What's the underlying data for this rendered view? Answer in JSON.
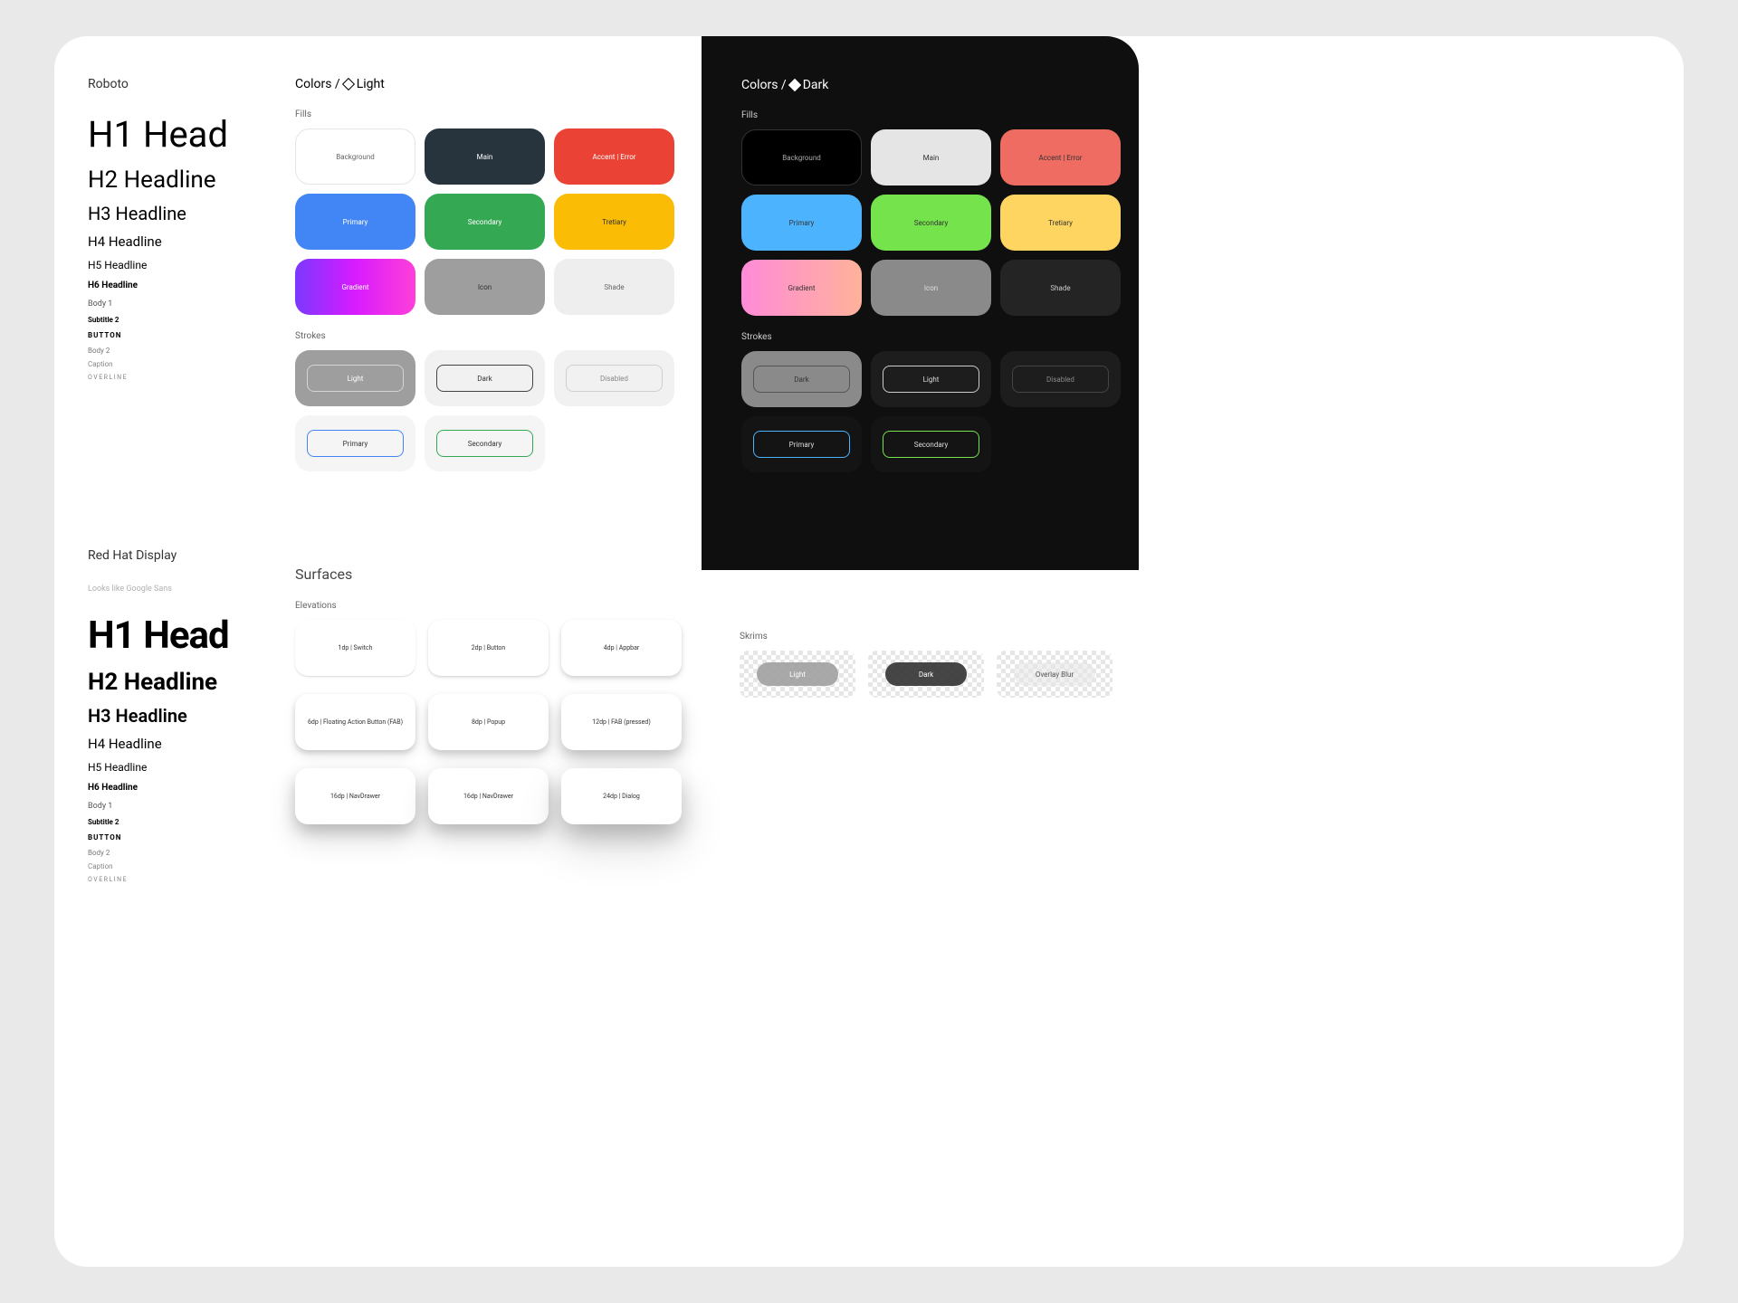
{
  "typography": {
    "roboto": {
      "title": "Roboto",
      "h1": "H1 Head",
      "h2": "H2 Headline",
      "h3": "H3 Headline",
      "h4": "H4 Headline",
      "h5": "H5 Headline",
      "h6": "H6 Headline",
      "body1": "Body 1",
      "subtitle2": "Subtitle 2",
      "button": "BUTTON",
      "body2": "Body 2",
      "caption": "Caption",
      "overline": "OVERLINE"
    },
    "redhat": {
      "title": "Red Hat Display",
      "subtitle": "Looks like Google Sans",
      "h1": "H1 Head",
      "h2": "H2 Headline",
      "h3": "H3 Headline",
      "h4": "H4 Headline",
      "h5": "H5 Headline",
      "h6": "H6 Headline",
      "body1": "Body 1",
      "subtitle2": "Subtitle 2",
      "button": "BUTTON",
      "body2": "Body 2",
      "caption": "Caption",
      "overline": "OVERLINE"
    }
  },
  "light": {
    "title_prefix": "Colors /",
    "title_mode": "Light",
    "fills_label": "Fills",
    "fills": [
      {
        "name": "Background",
        "color": "#ffffff",
        "text": "#666",
        "border": true
      },
      {
        "name": "Main",
        "color": "#27333d",
        "text": "#fff"
      },
      {
        "name": "Accent | Error",
        "color": "#ea4335",
        "text": "#fff"
      },
      {
        "name": "Primary",
        "color": "#4285f4",
        "text": "#fff"
      },
      {
        "name": "Secondary",
        "color": "#34a853",
        "text": "#fff"
      },
      {
        "name": "Tretiary",
        "color": "#fbbc05",
        "text": "#333"
      },
      {
        "name": "Gradient",
        "gradient": "linear-gradient(90deg,#7b38ff,#d81bff,#ff3fd8)",
        "text": "#fff"
      },
      {
        "name": "Icon",
        "color": "#9e9e9e",
        "text": "#333"
      },
      {
        "name": "Shade",
        "color": "#eeeeee",
        "text": "#666"
      }
    ],
    "strokes_label": "Strokes",
    "strokes": [
      {
        "name": "Light",
        "outer": "#9e9e9e",
        "inner_border": "#d4d4d4",
        "text": "#fff"
      },
      {
        "name": "Dark",
        "outer": "#f1f1f1",
        "inner_border": "#444",
        "text": "#333"
      },
      {
        "name": "Disabled",
        "outer": "#f1f1f1",
        "inner_border": "#cfcfcf",
        "text": "#888"
      },
      {
        "name": "Primary",
        "outer": "#f5f5f5",
        "inner_border": "#4285f4",
        "text": "#333"
      },
      {
        "name": "Secondary",
        "outer": "#f5f5f5",
        "inner_border": "#34a853",
        "text": "#333"
      }
    ]
  },
  "dark": {
    "title_prefix": "Colors /",
    "title_mode": "Dark",
    "fills_label": "Fills",
    "fills": [
      {
        "name": "Background",
        "color": "#000000",
        "text": "#aaa",
        "border": true
      },
      {
        "name": "Main",
        "color": "#e5e5e5",
        "text": "#333"
      },
      {
        "name": "Accent | Error",
        "color": "#ef6c62",
        "text": "#333"
      },
      {
        "name": "Primary",
        "color": "#4cb4ff",
        "text": "#333"
      },
      {
        "name": "Secondary",
        "color": "#74e34c",
        "text": "#333"
      },
      {
        "name": "Tretiary",
        "color": "#ffd561",
        "text": "#333"
      },
      {
        "name": "Gradient",
        "gradient": "linear-gradient(90deg,#ff8bd8,#ffb29a)",
        "text": "#333"
      },
      {
        "name": "Icon",
        "color": "#8a8a8a",
        "text": "#ddd"
      },
      {
        "name": "Shade",
        "color": "#242424",
        "text": "#ccc"
      }
    ],
    "strokes_label": "Strokes",
    "strokes": [
      {
        "name": "Dark",
        "outer": "#8a8a8a",
        "inner_border": "#555",
        "text": "#333"
      },
      {
        "name": "Light",
        "outer": "#1d1d1d",
        "inner_border": "#ccc",
        "text": "#ddd"
      },
      {
        "name": "Disabled",
        "outer": "#1d1d1d",
        "inner_border": "#444",
        "text": "#888"
      },
      {
        "name": "Primary",
        "outer": "#141414",
        "inner_border": "#4cb4ff",
        "text": "#ddd"
      },
      {
        "name": "Secondary",
        "outer": "#141414",
        "inner_border": "#74e34c",
        "text": "#ddd"
      }
    ]
  },
  "surfaces": {
    "title": "Surfaces",
    "elev_label": "Elevations",
    "elevations": [
      "1dp | Switch",
      "2dp | Button",
      "4dp | Appbar",
      "6dp | Floating Action Button (FAB)",
      "8dp | Popup",
      "12dp | FAB (pressed)",
      "16dp | NavDrawer",
      "16dp | NavDrawer",
      "24dp | Dialog"
    ],
    "skrims_label": "Skrims",
    "skrims": [
      {
        "name": "Light",
        "bg": "rgba(160,160,160,0.9)",
        "text": "#fff"
      },
      {
        "name": "Dark",
        "bg": "rgba(50,50,50,0.9)",
        "text": "#fff"
      },
      {
        "name": "Overlay Blur",
        "bg": "rgba(230,230,230,0.6)",
        "text": "#555"
      }
    ]
  }
}
